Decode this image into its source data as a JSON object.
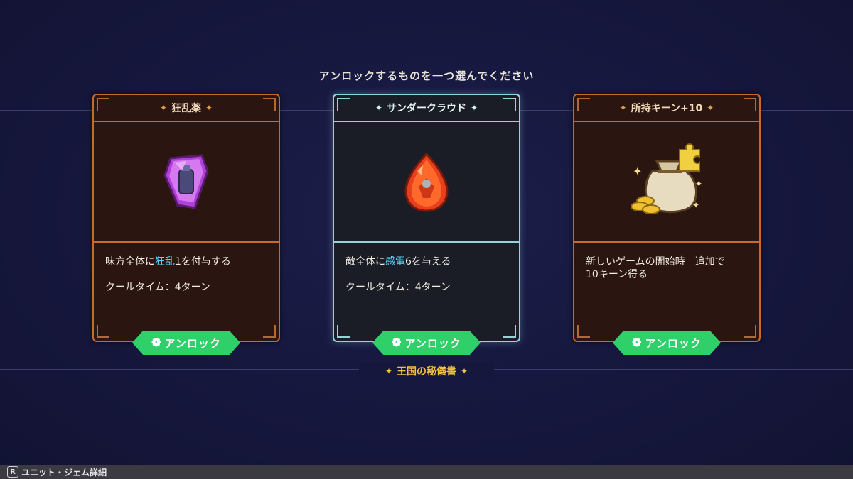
{
  "prompt": "アンロックするものを一つ選んでください",
  "cards": [
    {
      "title": "狂乱薬",
      "desc_pre": "味方全体に",
      "desc_hl": "狂乱",
      "desc_post": "1を付与する",
      "cooldown": "クールタイム：4ターン",
      "button": "アンロック",
      "icon": "purple-crystal-potion-icon"
    },
    {
      "title": "サンダークラウド",
      "desc_pre": "敵全体に",
      "desc_hl": "感電",
      "desc_post": "6を与える",
      "cooldown": "クールタイム：4ターン",
      "button": "アンロック",
      "icon": "red-teardrop-gem-icon"
    },
    {
      "title": "所持キーン+10",
      "desc": "新しいゲームの開始時　追加で10キーン得る",
      "button": "アンロック",
      "icon": "coin-bag-puzzle-icon"
    }
  ],
  "scroll_label": "王国の秘儀書",
  "bottom_bar": {
    "key": "R",
    "label": "ユニット・ジェム詳細"
  },
  "colors": {
    "card_border": "#c86a2a",
    "selected_border": "#8fd6d8",
    "unlock_green": "#2fcf6a",
    "highlight": "#56d8ff",
    "gold": "#f5c040"
  }
}
